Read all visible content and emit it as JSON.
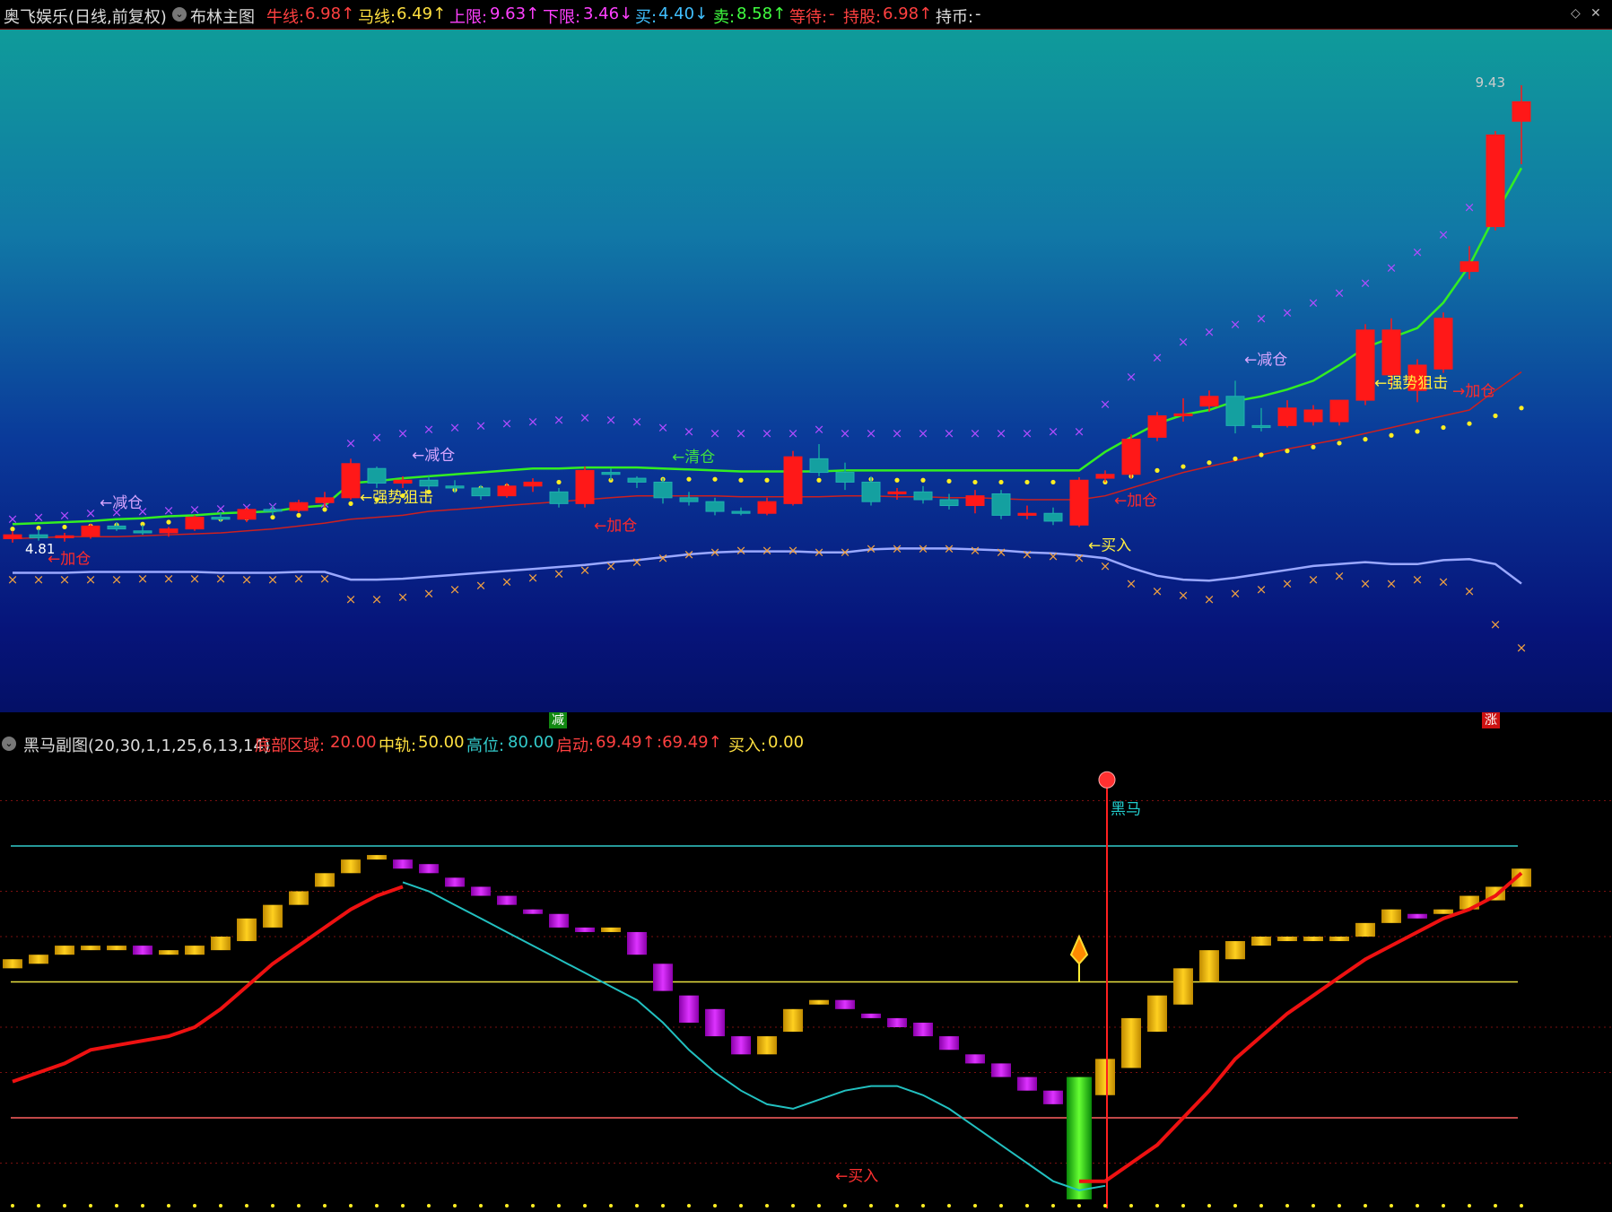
{
  "header": {
    "stock": "奥飞娱乐(日线,前复权)",
    "indicator": "布林主图",
    "niu_label": "牛线:",
    "niu_value": "6.98↑",
    "ma_label": "马线:",
    "ma_value": "6.49↑",
    "upper_label": "上限:",
    "upper_value": "9.63↑",
    "lower_label": "下限:",
    "lower_value": "3.46↓",
    "buy_label": "买:",
    "buy_value": "4.40↓",
    "sell_label": "卖:",
    "sell_value": "8.58↑",
    "wait_label": "等待:",
    "wait_value": "-",
    "hold_label": "持股:",
    "hold_value": "6.98↑",
    "cash_label": "持币:",
    "cash_value": "-"
  },
  "sub_header": {
    "title": "黑马副图(20,30,1,1,25,6,13,14)",
    "bottom_label": "底部区域:",
    "bottom_value": "20.00",
    "mid_label": "中轨:",
    "mid_value": "50.00",
    "high_label": "高位:",
    "high_value": "80.00",
    "start_label": "启动:",
    "start_value": "69.49↑",
    "start2_value": ":69.49↑",
    "buy_label": "买入:",
    "buy_value": "0.00"
  },
  "markers": {
    "jian_label": "减",
    "zhang_label": "涨",
    "price_high": "9.43",
    "price_low": "4.81",
    "heima": "黑马",
    "sub_buy": "←买入"
  },
  "signals": [
    {
      "i": 3,
      "text": "←减仓",
      "color": "#d8a6ff",
      "y": "above"
    },
    {
      "i": 1,
      "text": "←加仓",
      "color": "#ff2a2a",
      "y": "below"
    },
    {
      "i": 13,
      "text": "←强势狙击",
      "color": "#ffef40",
      "y": "mid"
    },
    {
      "i": 15,
      "text": "←减仓",
      "color": "#d8a6ff",
      "y": "above"
    },
    {
      "i": 22,
      "text": "←加仓",
      "color": "#ff2a2a",
      "y": "below"
    },
    {
      "i": 25,
      "text": "←清仓",
      "color": "#40e040",
      "y": "above"
    },
    {
      "i": 41,
      "text": "←买入",
      "color": "#ffef40",
      "y": "below"
    },
    {
      "i": 42,
      "text": "←加仓",
      "color": "#ff2a2a",
      "y": "below"
    },
    {
      "i": 47,
      "text": "←减仓",
      "color": "#d8a6ff",
      "y": "above"
    },
    {
      "i": 52,
      "text": "←强势狙击",
      "color": "#ffef40",
      "y": "mid"
    },
    {
      "i": 55,
      "text": "→加仓",
      "color": "#ff2a2a",
      "y": "below"
    }
  ],
  "chart_data": [
    {
      "type": "candlestick",
      "title": "布林主图",
      "ylim": [
        3.0,
        10.0
      ],
      "candles": [
        [
          4.78,
          4.86,
          4.74,
          4.82
        ],
        [
          4.82,
          4.88,
          4.76,
          4.79
        ],
        [
          4.79,
          4.84,
          4.75,
          4.81
        ],
        [
          4.81,
          4.93,
          4.78,
          4.91
        ],
        [
          4.91,
          4.95,
          4.86,
          4.88
        ],
        [
          4.86,
          4.92,
          4.82,
          4.84
        ],
        [
          4.84,
          4.9,
          4.8,
          4.88
        ],
        [
          4.88,
          5.02,
          4.86,
          5.0
        ],
        [
          5.0,
          5.05,
          4.95,
          4.98
        ],
        [
          4.98,
          5.1,
          4.95,
          5.08
        ],
        [
          5.08,
          5.12,
          5.02,
          5.07
        ],
        [
          5.07,
          5.18,
          5.05,
          5.15
        ],
        [
          5.15,
          5.26,
          5.1,
          5.2
        ],
        [
          5.2,
          5.6,
          5.18,
          5.55
        ],
        [
          5.5,
          5.52,
          5.3,
          5.35
        ],
        [
          5.35,
          5.42,
          5.3,
          5.38
        ],
        [
          5.38,
          5.42,
          5.28,
          5.32
        ],
        [
          5.32,
          5.38,
          5.25,
          5.3
        ],
        [
          5.3,
          5.33,
          5.18,
          5.22
        ],
        [
          5.22,
          5.35,
          5.2,
          5.32
        ],
        [
          5.32,
          5.4,
          5.26,
          5.36
        ],
        [
          5.26,
          5.3,
          5.1,
          5.14
        ],
        [
          5.14,
          5.52,
          5.1,
          5.48
        ],
        [
          5.46,
          5.5,
          5.38,
          5.44
        ],
        [
          5.4,
          5.42,
          5.3,
          5.36
        ],
        [
          5.36,
          5.4,
          5.14,
          5.2
        ],
        [
          5.2,
          5.26,
          5.12,
          5.16
        ],
        [
          5.16,
          5.2,
          5.02,
          5.06
        ],
        [
          5.06,
          5.1,
          5.02,
          5.04
        ],
        [
          5.04,
          5.2,
          5.02,
          5.16
        ],
        [
          5.14,
          5.68,
          5.12,
          5.62
        ],
        [
          5.6,
          5.75,
          5.42,
          5.46
        ],
        [
          5.46,
          5.56,
          5.28,
          5.36
        ],
        [
          5.36,
          5.42,
          5.12,
          5.16
        ],
        [
          5.24,
          5.3,
          5.18,
          5.26
        ],
        [
          5.26,
          5.32,
          5.14,
          5.18
        ],
        [
          5.18,
          5.24,
          5.08,
          5.12
        ],
        [
          5.12,
          5.28,
          5.04,
          5.22
        ],
        [
          5.24,
          5.28,
          4.98,
          5.02
        ],
        [
          5.02,
          5.12,
          4.98,
          5.04
        ],
        [
          5.04,
          5.1,
          4.92,
          4.96
        ],
        [
          4.92,
          5.41,
          4.9,
          5.38
        ],
        [
          5.4,
          5.48,
          5.36,
          5.44
        ],
        [
          5.44,
          5.85,
          5.4,
          5.8
        ],
        [
          5.82,
          6.08,
          5.78,
          6.04
        ],
        [
          6.04,
          6.22,
          5.98,
          6.06
        ],
        [
          6.14,
          6.3,
          6.08,
          6.24
        ],
        [
          6.24,
          6.4,
          5.86,
          5.94
        ],
        [
          5.94,
          6.12,
          5.88,
          5.92
        ],
        [
          5.94,
          6.2,
          5.92,
          6.12
        ],
        [
          5.98,
          6.15,
          5.94,
          6.1
        ],
        [
          5.98,
          6.2,
          5.94,
          6.2
        ],
        [
          6.2,
          6.98,
          6.15,
          6.92
        ],
        [
          6.46,
          7.04,
          6.34,
          6.92
        ],
        [
          6.3,
          6.62,
          6.18,
          6.56
        ],
        [
          6.52,
          7.1,
          6.48,
          7.04
        ],
        [
          7.52,
          7.78,
          7.44,
          7.62
        ],
        [
          7.98,
          8.96,
          7.94,
          8.92
        ],
        [
          9.06,
          9.43,
          8.62,
          9.26
        ]
      ],
      "series": [
        {
          "name": "牛线",
          "values": [
            4.93,
            4.94,
            4.95,
            4.96,
            4.98,
            4.99,
            5.01,
            5.02,
            5.04,
            5.05,
            5.06,
            5.1,
            5.12,
            5.35,
            5.37,
            5.4,
            5.42,
            5.44,
            5.46,
            5.48,
            5.5,
            5.5,
            5.51,
            5.51,
            5.51,
            5.5,
            5.49,
            5.48,
            5.47,
            5.47,
            5.47,
            5.47,
            5.48,
            5.48,
            5.48,
            5.48,
            5.48,
            5.48,
            5.48,
            5.48,
            5.48,
            5.48,
            5.67,
            5.82,
            5.96,
            6.05,
            6.1,
            6.19,
            6.24,
            6.31,
            6.4,
            6.56,
            6.74,
            6.84,
            6.94,
            7.2,
            7.58,
            8.1,
            8.58
          ]
        },
        {
          "name": "马线",
          "values": [
            4.78,
            4.79,
            4.8,
            4.8,
            4.8,
            4.81,
            4.82,
            4.83,
            4.84,
            4.86,
            4.88,
            4.91,
            4.94,
            4.98,
            5.0,
            5.02,
            5.06,
            5.08,
            5.1,
            5.12,
            5.14,
            5.16,
            5.18,
            5.2,
            5.22,
            5.22,
            5.22,
            5.22,
            5.21,
            5.21,
            5.21,
            5.21,
            5.22,
            5.22,
            5.21,
            5.21,
            5.2,
            5.2,
            5.19,
            5.18,
            5.18,
            5.18,
            5.22,
            5.3,
            5.38,
            5.46,
            5.52,
            5.58,
            5.64,
            5.7,
            5.75,
            5.8,
            5.86,
            5.92,
            5.98,
            6.04,
            6.1,
            6.3,
            6.49
          ]
        },
        {
          "name": "下限",
          "values": [
            4.43,
            4.43,
            4.43,
            4.44,
            4.44,
            4.44,
            4.44,
            4.44,
            4.43,
            4.43,
            4.43,
            4.44,
            4.44,
            4.36,
            4.36,
            4.37,
            4.39,
            4.41,
            4.43,
            4.45,
            4.47,
            4.49,
            4.51,
            4.54,
            4.56,
            4.59,
            4.62,
            4.64,
            4.65,
            4.65,
            4.65,
            4.64,
            4.64,
            4.67,
            4.68,
            4.68,
            4.68,
            4.67,
            4.66,
            4.64,
            4.63,
            4.61,
            4.58,
            4.48,
            4.4,
            4.36,
            4.35,
            4.38,
            4.42,
            4.46,
            4.5,
            4.52,
            4.54,
            4.52,
            4.52,
            4.56,
            4.57,
            4.52,
            4.32
          ]
        },
        {
          "name": "买",
          "values": [
            4.88,
            4.89,
            4.9,
            4.91,
            4.92,
            4.93,
            4.95,
            4.96,
            4.98,
            4.99,
            5.0,
            5.02,
            5.08,
            5.14,
            5.18,
            5.22,
            5.26,
            5.28,
            5.3,
            5.32,
            5.34,
            5.36,
            5.37,
            5.38,
            5.38,
            5.39,
            5.39,
            5.39,
            5.38,
            5.38,
            5.37,
            5.38,
            5.38,
            5.39,
            5.38,
            5.38,
            5.37,
            5.36,
            5.36,
            5.36,
            5.36,
            5.35,
            5.36,
            5.42,
            5.48,
            5.52,
            5.56,
            5.6,
            5.64,
            5.68,
            5.72,
            5.76,
            5.8,
            5.84,
            5.88,
            5.92,
            5.96,
            6.04,
            6.12
          ]
        },
        {
          "name": "上限x",
          "values": [
            4.98,
            5.0,
            5.02,
            5.04,
            5.05,
            5.06,
            5.07,
            5.08,
            5.09,
            5.1,
            5.11,
            5.12,
            5.14,
            5.76,
            5.82,
            5.86,
            5.9,
            5.92,
            5.94,
            5.96,
            5.98,
            6.0,
            6.02,
            6.0,
            5.98,
            5.92,
            5.88,
            5.86,
            5.86,
            5.86,
            5.86,
            5.9,
            5.86,
            5.86,
            5.86,
            5.86,
            5.86,
            5.86,
            5.86,
            5.86,
            5.88,
            5.88,
            6.16,
            6.44,
            6.64,
            6.8,
            6.9,
            6.98,
            7.04,
            7.1,
            7.2,
            7.3,
            7.4,
            7.56,
            7.72,
            7.9,
            8.18,
            8.7,
            9.2
          ]
        },
        {
          "name": "下限x",
          "values": [
            4.36,
            4.36,
            4.36,
            4.36,
            4.36,
            4.37,
            4.37,
            4.37,
            4.37,
            4.36,
            4.36,
            4.37,
            4.37,
            4.16,
            4.16,
            4.18,
            4.22,
            4.26,
            4.3,
            4.34,
            4.38,
            4.42,
            4.46,
            4.5,
            4.54,
            4.58,
            4.62,
            4.64,
            4.66,
            4.66,
            4.66,
            4.64,
            4.64,
            4.68,
            4.68,
            4.68,
            4.68,
            4.66,
            4.64,
            4.62,
            4.6,
            4.58,
            4.5,
            4.32,
            4.24,
            4.2,
            4.16,
            4.22,
            4.26,
            4.32,
            4.36,
            4.4,
            4.32,
            4.32,
            4.36,
            4.34,
            4.24,
            3.9,
            3.66
          ]
        }
      ]
    },
    {
      "type": "bar",
      "title": "黑马副图",
      "ylim": [
        0,
        100
      ],
      "bars": [
        [
          53,
          55
        ],
        [
          54,
          56
        ],
        [
          56,
          58
        ],
        [
          57,
          58
        ],
        [
          57,
          58
        ],
        [
          56,
          58
        ],
        [
          56,
          57
        ],
        [
          56,
          58
        ],
        [
          57,
          60
        ],
        [
          59,
          64
        ],
        [
          62,
          67
        ],
        [
          67,
          70
        ],
        [
          71,
          74
        ],
        [
          74,
          77
        ],
        [
          77,
          78
        ],
        [
          75,
          77
        ],
        [
          74,
          76
        ],
        [
          71,
          73
        ],
        [
          69,
          71
        ],
        [
          67,
          69
        ],
        [
          65,
          66
        ],
        [
          62,
          65
        ],
        [
          61,
          62
        ],
        [
          61,
          62
        ],
        [
          56,
          61
        ],
        [
          48,
          54
        ],
        [
          41,
          47
        ],
        [
          38,
          44
        ],
        [
          34,
          38
        ],
        [
          34,
          38
        ],
        [
          39,
          44
        ],
        [
          45,
          46
        ],
        [
          44,
          46
        ],
        [
          42,
          43
        ],
        [
          40,
          42
        ],
        [
          38,
          41
        ],
        [
          35,
          38
        ],
        [
          32,
          34
        ],
        [
          29,
          32
        ],
        [
          26,
          29
        ],
        [
          23,
          26
        ],
        [
          2,
          29
        ],
        [
          25,
          33
        ],
        [
          31,
          42
        ],
        [
          39,
          47
        ],
        [
          45,
          53
        ],
        [
          50,
          57
        ],
        [
          55,
          59
        ],
        [
          58,
          60
        ],
        [
          59,
          60
        ],
        [
          59,
          60
        ],
        [
          59,
          60
        ],
        [
          60,
          63
        ],
        [
          63,
          66
        ],
        [
          64,
          65
        ],
        [
          65,
          66
        ],
        [
          66,
          69
        ],
        [
          68,
          71
        ],
        [
          71,
          75
        ]
      ],
      "bar_colors": [
        "gold",
        "gold",
        "gold",
        "gold",
        "gold",
        "purple",
        "gold",
        "gold",
        "gold",
        "gold",
        "gold",
        "gold",
        "gold",
        "gold",
        "gold",
        "purple",
        "purple",
        "purple",
        "purple",
        "purple",
        "purple",
        "purple",
        "purple",
        "gold",
        "purple",
        "purple",
        "purple",
        "purple",
        "purple",
        "gold",
        "gold",
        "gold",
        "purple",
        "purple",
        "purple",
        "purple",
        "purple",
        "purple",
        "purple",
        "purple",
        "purple",
        "green",
        "gold",
        "gold",
        "gold",
        "gold",
        "gold",
        "gold",
        "gold",
        "gold",
        "gold",
        "gold",
        "gold",
        "gold",
        "purple",
        "gold",
        "gold",
        "gold",
        "gold"
      ],
      "red_line": [
        28,
        30,
        32,
        35,
        36,
        37,
        38,
        40,
        44,
        49,
        54,
        58,
        62,
        66,
        69,
        71,
        72,
        72,
        71,
        69,
        65,
        60,
        56,
        54,
        51,
        44,
        35,
        30,
        26,
        23,
        23,
        26,
        29,
        31,
        31,
        29,
        27,
        23,
        19,
        15,
        11,
        6,
        6,
        10,
        14,
        20,
        26,
        33,
        38,
        43,
        47,
        51,
        55,
        58,
        61,
        64,
        66,
        69,
        74
      ],
      "cyan_line": [
        null,
        null,
        null,
        null,
        null,
        null,
        null,
        null,
        null,
        null,
        null,
        null,
        null,
        null,
        null,
        72,
        70,
        67,
        64,
        61,
        58,
        55,
        52,
        49,
        46,
        41,
        35,
        30,
        26,
        23,
        22,
        24,
        26,
        27,
        27,
        25,
        22,
        18,
        14,
        10,
        6,
        4,
        5,
        null,
        null,
        null,
        null,
        null,
        null,
        null,
        null,
        null,
        null,
        null,
        null,
        null,
        null,
        null,
        null
      ],
      "hlines": [
        {
          "y": 80,
          "color": "#33cccc"
        },
        {
          "y": 50,
          "color": "#e8e040"
        },
        {
          "y": 20,
          "color": "#ff6060"
        }
      ]
    }
  ]
}
